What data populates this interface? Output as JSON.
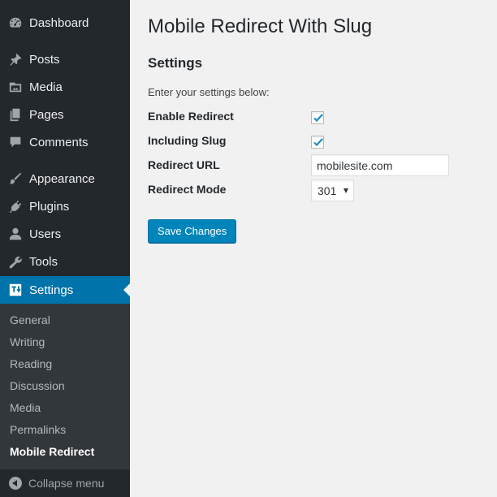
{
  "sidebar": {
    "items": [
      {
        "label": "Dashboard",
        "icon": "dashboard-icon"
      },
      {
        "label": "Posts",
        "icon": "pin-icon"
      },
      {
        "label": "Media",
        "icon": "media-icon"
      },
      {
        "label": "Pages",
        "icon": "pages-icon"
      },
      {
        "label": "Comments",
        "icon": "comment-icon"
      },
      {
        "label": "Appearance",
        "icon": "paintbrush-icon"
      },
      {
        "label": "Plugins",
        "icon": "plug-icon"
      },
      {
        "label": "Users",
        "icon": "user-icon"
      },
      {
        "label": "Tools",
        "icon": "wrench-icon"
      },
      {
        "label": "Settings",
        "icon": "settings-icon",
        "current": true
      }
    ],
    "submenu": [
      {
        "label": "General"
      },
      {
        "label": "Writing"
      },
      {
        "label": "Reading"
      },
      {
        "label": "Discussion"
      },
      {
        "label": "Media"
      },
      {
        "label": "Permalinks"
      },
      {
        "label": "Mobile Redirect",
        "current": true
      }
    ],
    "collapse_label": "Collapse menu"
  },
  "main": {
    "title": "Mobile Redirect With Slug",
    "section_title": "Settings",
    "intro": "Enter your settings below:",
    "fields": {
      "enable_redirect": {
        "label": "Enable Redirect",
        "checked": true
      },
      "including_slug": {
        "label": "Including Slug",
        "checked": true
      },
      "redirect_url": {
        "label": "Redirect URL",
        "value": "mobilesite.com"
      },
      "redirect_mode": {
        "label": "Redirect Mode",
        "value": "301"
      }
    },
    "save_label": "Save Changes"
  },
  "colors": {
    "sidebar_bg": "#23282d",
    "submenu_bg": "#32373c",
    "accent": "#0073aa",
    "button": "#0085ba",
    "page_bg": "#f1f1f1"
  }
}
